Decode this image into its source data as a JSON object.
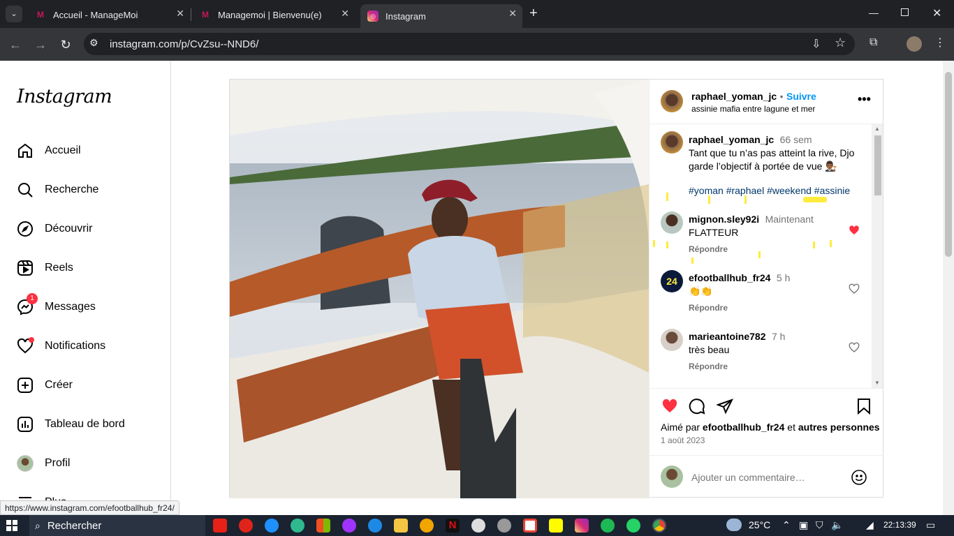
{
  "browser": {
    "tabs": [
      {
        "title": "Accueil - ManageMoi",
        "active": false
      },
      {
        "title": "Managemoi | Bienvenu(e)",
        "active": false
      },
      {
        "title": "Instagram",
        "active": true
      }
    ],
    "url": "instagram.com/p/CvZsu--NND6/",
    "status_url": "https://www.instagram.com/efootballhub_fr24/"
  },
  "sidebar": {
    "logo": "Instagram",
    "items": [
      {
        "label": "Accueil",
        "icon": "home-icon"
      },
      {
        "label": "Recherche",
        "icon": "search-icon"
      },
      {
        "label": "Découvrir",
        "icon": "compass-icon"
      },
      {
        "label": "Reels",
        "icon": "reels-icon"
      },
      {
        "label": "Messages",
        "icon": "messenger-icon",
        "badge": "1"
      },
      {
        "label": "Notifications",
        "icon": "heart-icon"
      },
      {
        "label": "Créer",
        "icon": "plus-square-icon"
      },
      {
        "label": "Tableau de bord",
        "icon": "dashboard-icon"
      },
      {
        "label": "Profil",
        "icon": "avatar"
      },
      {
        "label": "Plus",
        "icon": "menu-icon"
      }
    ]
  },
  "post": {
    "header": {
      "username": "raphael_yoman_jc",
      "separator": "•",
      "follow": "Suivre",
      "location": "assinie mafia entre lagune et mer"
    },
    "caption": {
      "username": "raphael_yoman_jc",
      "time": "66 sem",
      "text": "Tant que tu n’as pas atteint la rive, Djo garde l’objectif à portée de vue 👨🏾‍⚖️",
      "hashtags": "#yoman #raphael #weekend #assinie"
    },
    "comments": [
      {
        "username": "mignon.sley92i",
        "time": "Maintenant",
        "text": "FLATTEUR",
        "reply": "Répondre",
        "liked": true
      },
      {
        "username": "efootballhub_fr24",
        "time": "5 h",
        "text": "👏👏",
        "reply": "Répondre",
        "liked": false
      },
      {
        "username": "marieantoine782",
        "time": "7 h",
        "text": "très beau",
        "reply": "Répondre",
        "liked": false
      }
    ],
    "likes": {
      "prefix": "Aimé par",
      "user": "efootballhub_fr24",
      "joiner": "et",
      "others": "autres personnes"
    },
    "date": "1 août 2023",
    "comment_placeholder": "Ajouter un commentaire…"
  },
  "taskbar": {
    "search": "Rechercher",
    "weather": "25°C",
    "time": "22:13:39"
  },
  "colors": {
    "follow": "#0095f6",
    "like": "#ff3040",
    "hashtag": "#00376b"
  }
}
